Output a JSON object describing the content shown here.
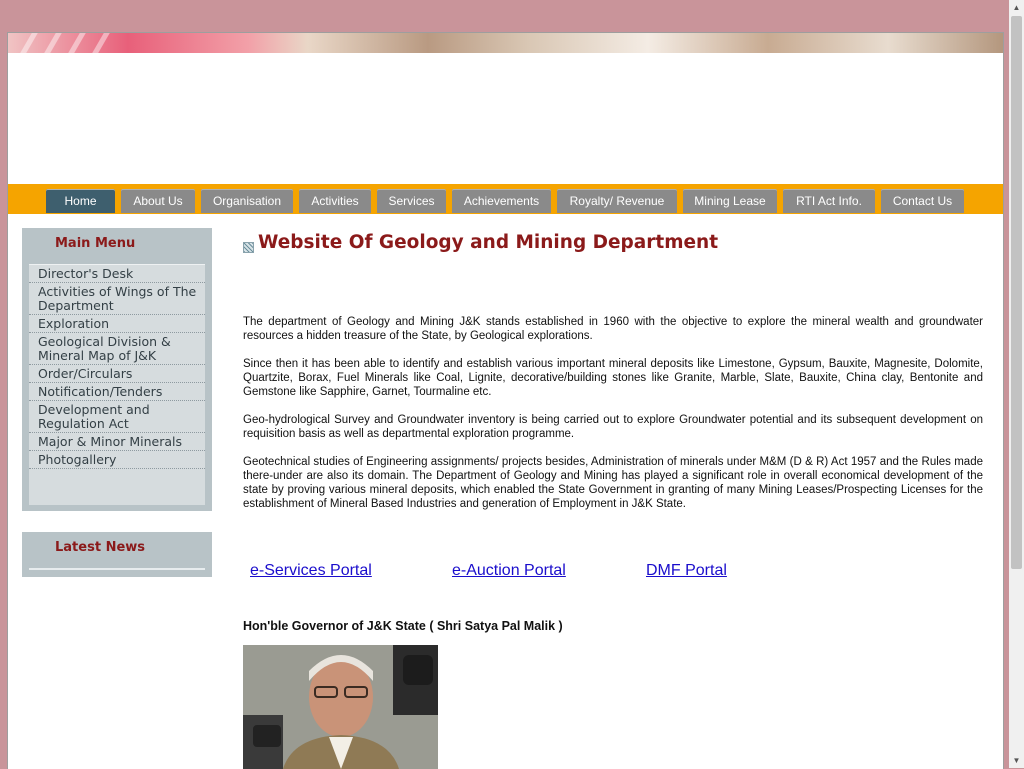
{
  "nav": {
    "items": [
      {
        "label": "Home",
        "active": true
      },
      {
        "label": "About Us",
        "active": false
      },
      {
        "label": "Organisation",
        "active": false
      },
      {
        "label": "Activities",
        "active": false
      },
      {
        "label": "Services",
        "active": false
      },
      {
        "label": "Achievements",
        "active": false
      },
      {
        "label": "Royalty/ Revenue",
        "active": false
      },
      {
        "label": "Mining Lease",
        "active": false
      },
      {
        "label": "RTI Act Info.",
        "active": false
      },
      {
        "label": "Contact Us",
        "active": false
      }
    ]
  },
  "sidebar": {
    "main_menu_title": "Main Menu",
    "menu_items": [
      "Director's Desk",
      "Activities of Wings of The Department",
      "Exploration",
      "Geological Division & Mineral Map of J&K",
      "Order/Circulars",
      "Notification/Tenders",
      "Development and Regulation Act",
      "Major & Minor Minerals",
      "Photogallery"
    ],
    "latest_news_title": "Latest News"
  },
  "main": {
    "title": "Website Of Geology and Mining Department",
    "paragraphs": [
      "The department of Geology and Mining J&K stands established in 1960 with the objective to explore the mineral wealth and groundwater resources a hidden treasure of the State, by Geological explorations.",
      "Since then it has been able to identify and establish various important mineral deposits like Limestone, Gypsum, Bauxite, Magnesite, Dolomite, Quartzite, Borax, Fuel Minerals like Coal, Lignite, decorative/building stones like Granite, Marble, Slate, Bauxite, China clay, Bentonite and Gemstone like Sapphire, Garnet, Tourmaline etc.",
      "Geo-hydrological Survey and Groundwater inventory is being carried out to explore Groundwater potential and its subsequent development on requisition basis as well as departmental exploration programme.",
      "Geotechnical studies of Engineering assignments/ projects besides, Administration of minerals under M&M (D & R) Act 1957 and the Rules made there-under are also its domain. The Department of Geology and Mining has played a significant role in overall economical development of the state by proving various mineral deposits, which enabled the State Government in granting of many Mining Leases/Prospecting Licenses for the establishment of Mineral Based Industries and generation of Employment in J&K State."
    ],
    "portals": [
      "e-Services Portal",
      "e-Auction Portal",
      "DMF Portal"
    ],
    "governor_caption": "Hon'ble Governor of J&K State ( Shri Satya Pal Malik )"
  },
  "colors": {
    "background": "#c9949a",
    "nav_bar": "#f5a400",
    "nav_tab": "#8a8a8a",
    "nav_tab_active": "#3e5f6e",
    "heading": "#8b1a1a",
    "sidebar_box": "#b8c3c7",
    "link": "#1a0dcc"
  },
  "icons": {
    "title_bullet": "checkered-square-icon",
    "scroll_up": "arrow-up-icon",
    "scroll_down": "arrow-down-icon"
  }
}
